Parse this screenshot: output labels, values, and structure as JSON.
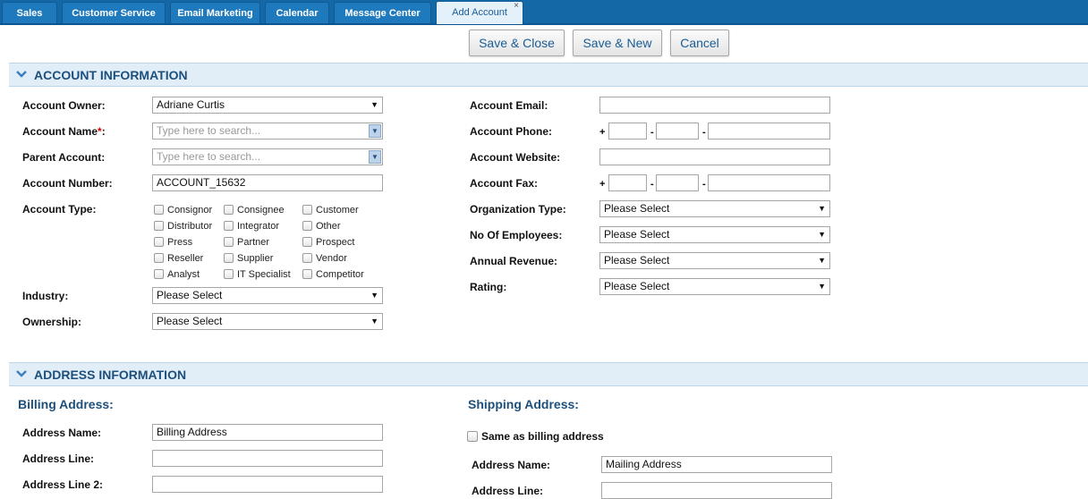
{
  "tabs": [
    {
      "label": "Sales"
    },
    {
      "label": "Customer Service"
    },
    {
      "label": "Email Marketing"
    },
    {
      "label": "Calendar"
    },
    {
      "label": "Message Center"
    },
    {
      "label": "Add Account",
      "close": "×"
    }
  ],
  "toolbar": {
    "save_close": "Save & Close",
    "save_new": "Save & New",
    "cancel": "Cancel"
  },
  "account_section": {
    "title": "ACCOUNT INFORMATION",
    "owner_label": "Account Owner:",
    "owner_value": "Adriane Curtis",
    "name_label": "Account Name",
    "name_required": "*",
    "name_colon": ":",
    "name_placeholder": "Type here to search...",
    "parent_label": "Parent Account:",
    "parent_placeholder": "Type here to search...",
    "number_label": "Account Number:",
    "number_value": "ACCOUNT_15632",
    "type_label": "Account Type:",
    "types": [
      "Consignor",
      "Consignee",
      "Customer",
      "Distributor",
      "Integrator",
      "Other",
      "Press",
      "Partner",
      "Prospect",
      "Reseller",
      "Supplier",
      "Vendor",
      "Analyst",
      "IT Specialist",
      "Competitor"
    ],
    "industry_label": "Industry:",
    "industry_value": "Please Select",
    "ownership_label": "Ownership:",
    "ownership_value": "Please Select",
    "email_label": "Account Email:",
    "phone_label": "Account Phone:",
    "website_label": "Account Website:",
    "fax_label": "Account Fax:",
    "org_type_label": "Organization Type:",
    "org_type_value": "Please Select",
    "employees_label": "No Of Employees:",
    "employees_value": "Please Select",
    "revenue_label": "Annual Revenue:",
    "revenue_value": "Please Select",
    "rating_label": "Rating:",
    "rating_value": "Please Select",
    "plus": "+",
    "dash": "-"
  },
  "address_section": {
    "title": "ADDRESS INFORMATION",
    "billing_title": "Billing Address:",
    "billing_name_label": "Address Name:",
    "billing_name_value": "Billing Address",
    "billing_line_label": "Address Line:",
    "billing_line2_label": "Address Line 2:",
    "shipping_title": "Shipping Address:",
    "same_as_billing": "Same as billing address",
    "shipping_name_label": "Address Name:",
    "shipping_name_value": "Mailing Address",
    "shipping_line_label": "Address Line:"
  },
  "colors": {
    "tabbar": "#1568a6",
    "section_bg": "#e1eef8",
    "heading": "#1d4f7c",
    "required": "#dd0000"
  }
}
